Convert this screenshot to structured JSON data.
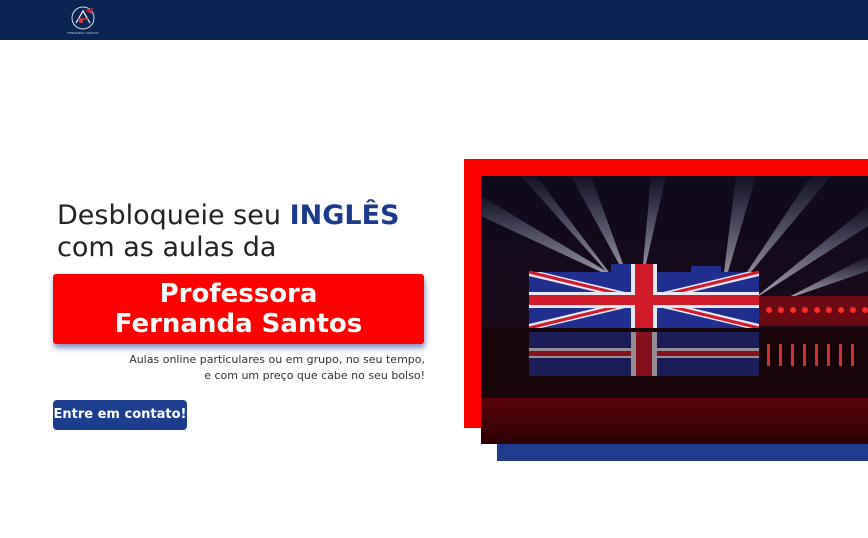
{
  "header": {
    "logo_icon": "logo-emblem-icon",
    "logo_text": "FERNANDA SANTOS"
  },
  "hero": {
    "line1_prefix": "Desbloqueie seu ",
    "line1_highlight": "INGLÊS",
    "line2": "com as aulas da",
    "name_line1": "Professora",
    "name_line2": "Fernanda Santos",
    "tagline_line1": "Aulas online particulares ou em grupo, no seu tempo,",
    "tagline_line2": "e com um preço que cabe no seu bolso!",
    "cta_label": "Entre em contato!"
  },
  "image": {
    "subject": "castle-lit-with-union-jack-photo"
  },
  "colors": {
    "navbar": "#0a2554",
    "accent_red": "#ff0000",
    "accent_blue": "#1d3d8f"
  }
}
